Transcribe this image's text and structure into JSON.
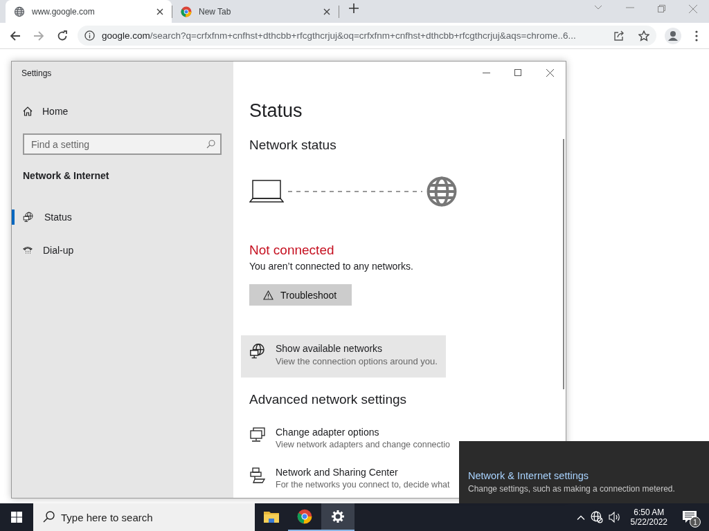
{
  "browser": {
    "tabs": [
      {
        "title": "www.google.com",
        "kind": "globe",
        "selected": true
      },
      {
        "title": "New Tab",
        "kind": "chrome",
        "selected": false
      }
    ],
    "address": {
      "domain": "google.com",
      "rest": "/search?q=crfxfnm+cnfhst+dthcbb+rfcgthcrjuj&oq=crfxfnm+cnfhst+dthcbb+rfcgthcrjuj&aqs=chrome..6..."
    }
  },
  "settings": {
    "window_title": "Settings",
    "sidebar": {
      "home": "Home",
      "search": {
        "placeholder": "Find a setting"
      },
      "section": "Network & Internet",
      "items": [
        {
          "label": "Status",
          "kind": "globe",
          "selected": true
        },
        {
          "label": "Dial-up",
          "kind": "phone",
          "selected": false
        }
      ]
    },
    "main": {
      "heading": "Status",
      "network_status": "Network status",
      "status": "Not connected",
      "status_detail": "You aren’t connected to any networks.",
      "troubleshoot": "Troubleshoot",
      "show_networks": {
        "title": "Show available networks",
        "detail": "View the connection options around you."
      },
      "advanced_heading": "Advanced network settings",
      "links": [
        {
          "kind": "adapter",
          "title": "Change adapter options",
          "detail": "View network adapters and change connectio"
        },
        {
          "kind": "sharing",
          "title": "Network and Sharing Center",
          "detail": "For the networks you connect to, decide what"
        }
      ]
    }
  },
  "flyout": {
    "title": "Network & Internet settings",
    "detail": "Change settings, such as making a connection metered."
  },
  "taskbar": {
    "search": {
      "placeholder": "Type here to search"
    },
    "apps": [
      {
        "kind": "folder",
        "running": false,
        "selected": false
      },
      {
        "kind": "chrome",
        "running": true,
        "selected": false
      },
      {
        "kind": "gear",
        "running": true,
        "selected": true
      }
    ],
    "time": "6:50 AM",
    "date": "5/22/2022",
    "notifications": "1"
  }
}
